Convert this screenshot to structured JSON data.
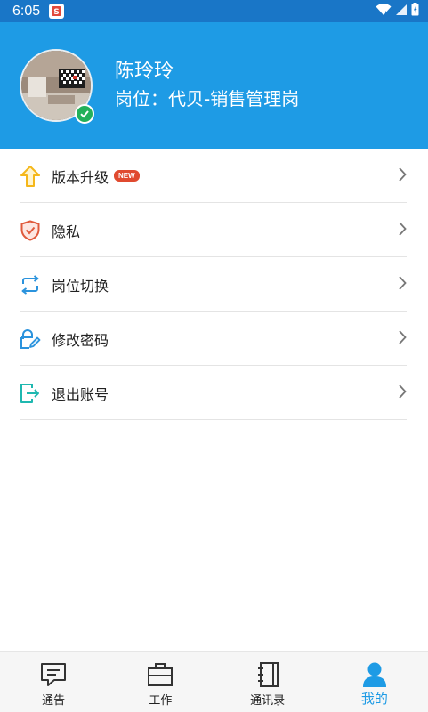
{
  "status_bar": {
    "time": "6:05",
    "app_icon": "app-badge-icon",
    "icons": [
      "wifi-icon",
      "signal-icon",
      "battery-icon"
    ]
  },
  "profile": {
    "name": "陈玲玲",
    "post": "岗位：代贝-销售管理岗",
    "verified_icon": "check-icon"
  },
  "menu": {
    "items": [
      {
        "label": "版本升级",
        "badge": "NEW",
        "icon": "upgrade-arrow-icon"
      },
      {
        "label": "隐私",
        "icon": "shield-icon"
      },
      {
        "label": "岗位切换",
        "icon": "switch-icon"
      },
      {
        "label": "修改密码",
        "icon": "edit-password-icon"
      },
      {
        "label": "退出账号",
        "icon": "logout-icon"
      }
    ]
  },
  "bottom_nav": {
    "items": [
      {
        "label": "通告",
        "icon": "message-icon"
      },
      {
        "label": "工作",
        "icon": "briefcase-icon"
      },
      {
        "label": "通讯录",
        "icon": "address-book-icon"
      },
      {
        "label": "我的",
        "icon": "person-icon",
        "active": true
      }
    ]
  },
  "colors": {
    "status_bar": "#1976c7",
    "header": "#1e9be5",
    "accent": "#1e9be5",
    "badge": "#e04a2f",
    "verified": "#23b05a"
  }
}
